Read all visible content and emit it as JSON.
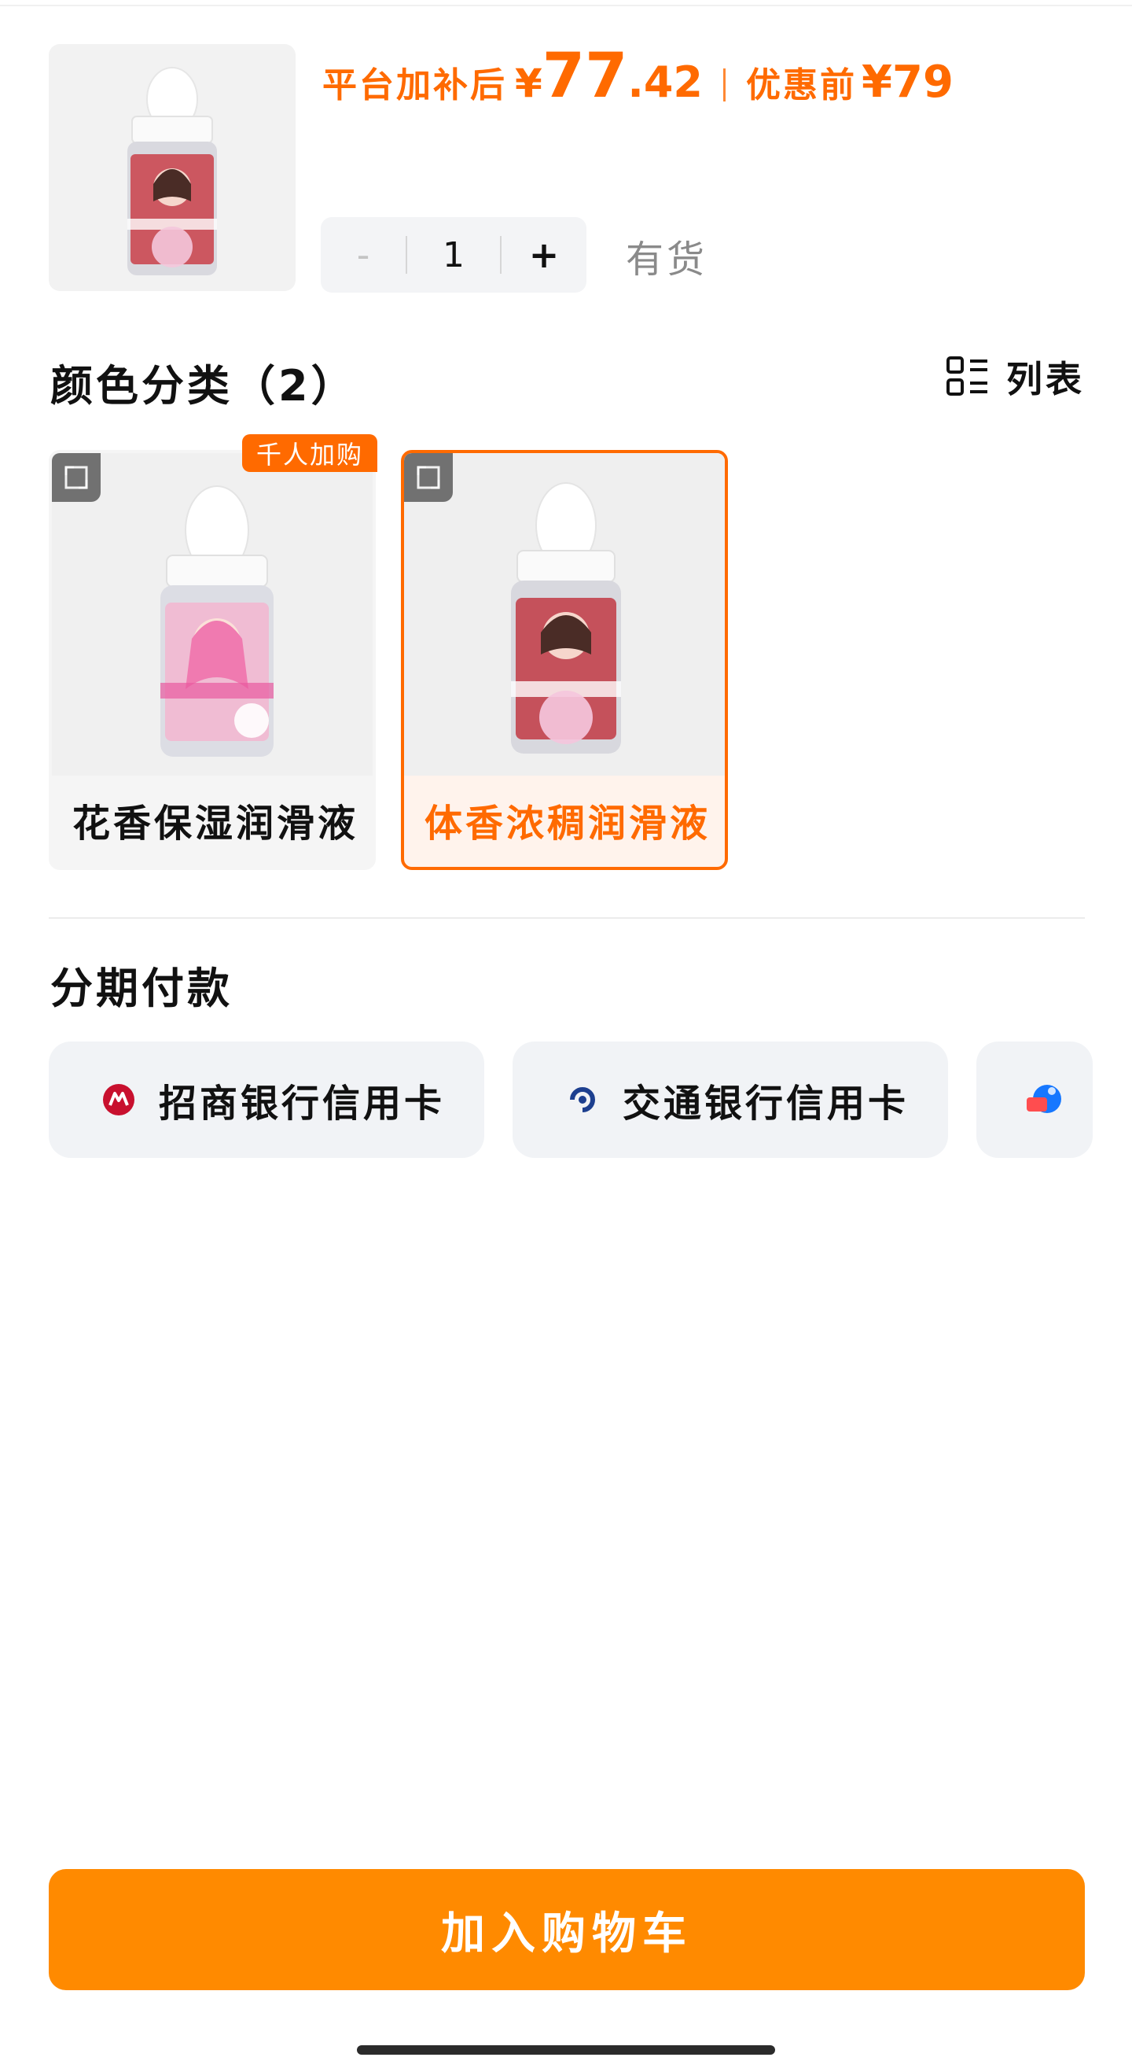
{
  "product": {
    "subsidy_label": "平台加补后",
    "currency": "¥",
    "price_integer": "77",
    "price_decimal": ".42",
    "original_label": "优惠前",
    "original_price": "¥79"
  },
  "quantity": {
    "minus": "-",
    "value": "1",
    "plus": "+",
    "stock_status": "有货"
  },
  "variants": {
    "title": "颜色分类（2）",
    "view_toggle_label": "列表",
    "hot_tag": "千人加购",
    "items": [
      {
        "label": "花香保湿润滑液",
        "selected": false
      },
      {
        "label": "体香浓稠润滑液",
        "selected": true
      }
    ]
  },
  "installment": {
    "title": "分期付款",
    "options": [
      {
        "label": "招商银行信用卡",
        "icon": "cmb-bank-icon"
      },
      {
        "label": "交通银行信用卡",
        "icon": "bocom-bank-icon"
      },
      {
        "label": "",
        "icon": "huabei-installment-icon"
      }
    ]
  },
  "cart": {
    "add_label": "加入购物车"
  },
  "colors": {
    "accent": "#ff6a00",
    "button": "#ff8a00"
  }
}
